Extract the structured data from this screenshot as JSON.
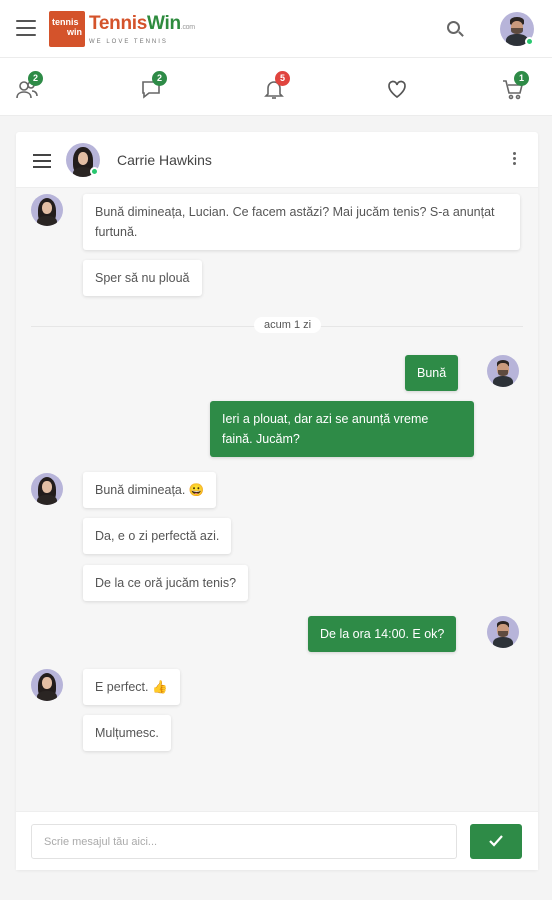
{
  "brand": {
    "logo_box_line1": "tennis",
    "logo_box_line2": "win",
    "name_part1": "Tennis",
    "name_part2": "Win",
    "domain": ".com",
    "tagline": "WE LOVE TENNIS"
  },
  "colors": {
    "brand_orange": "#d4532b",
    "brand_green": "#2e8b47",
    "badge_green": "#2e8b47",
    "badge_red": "#e0443e",
    "online": "#28c76f"
  },
  "header": {
    "menu_icon": "hamburger-icon",
    "search_icon": "search-icon",
    "user_avatar": "user-avatar"
  },
  "iconbar": {
    "items": [
      {
        "icon": "friends-icon",
        "badge": "2",
        "badge_color": "green"
      },
      {
        "icon": "messages-icon",
        "badge": "2",
        "badge_color": "green"
      },
      {
        "icon": "notifications-icon",
        "badge": "5",
        "badge_color": "red"
      },
      {
        "icon": "heart-icon",
        "badge": "",
        "badge_color": ""
      },
      {
        "icon": "cart-icon",
        "badge": "1",
        "badge_color": "green"
      }
    ]
  },
  "chat": {
    "contact_name": "Carrie Hawkins",
    "contact_online": true,
    "divider_label": "acum 1 zi",
    "messages": [
      {
        "from": "contact",
        "text": "Bună dimineața, Lucian. Ce facem astăzi? Mai jucăm tenis? S-a anunțat furtună."
      },
      {
        "from": "contact",
        "text": "Sper să nu plouă"
      },
      {
        "from": "me",
        "text": "Bună"
      },
      {
        "from": "me",
        "text": "Ieri a plouat, dar azi se anunță vreme faină. Jucăm?"
      },
      {
        "from": "contact",
        "text": "Bună dimineața. 😀"
      },
      {
        "from": "contact",
        "text": "Da, e o zi perfectă azi."
      },
      {
        "from": "contact",
        "text": "De la ce oră jucăm tenis?"
      },
      {
        "from": "me",
        "text": "De la ora 14:00. E ok?"
      },
      {
        "from": "contact",
        "text": "E perfect. 👍"
      },
      {
        "from": "contact",
        "text": "Mulțumesc."
      }
    ],
    "input_placeholder": "Scrie mesajul tău aici...",
    "input_value": "",
    "send_icon": "check-icon"
  }
}
